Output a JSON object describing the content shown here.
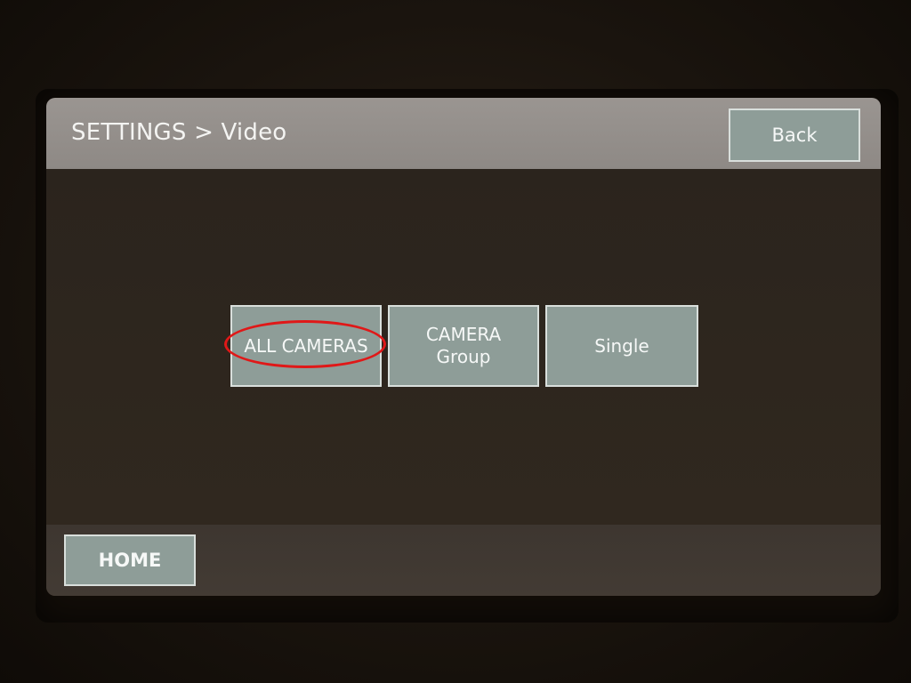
{
  "header": {
    "title": "SETTINGS > Video",
    "back_label": "Back"
  },
  "modes": {
    "all_cameras": {
      "label": "ALL CAMERAS",
      "highlighted": true
    },
    "camera_group": {
      "line1": "CAMERA",
      "line2": "Group"
    },
    "single": {
      "label": "Single"
    }
  },
  "footer": {
    "home_label": "HOME"
  },
  "colors": {
    "button_fill": "#8e9d98",
    "header_bar": "#9a9591",
    "highlight_ring": "#e01818"
  }
}
